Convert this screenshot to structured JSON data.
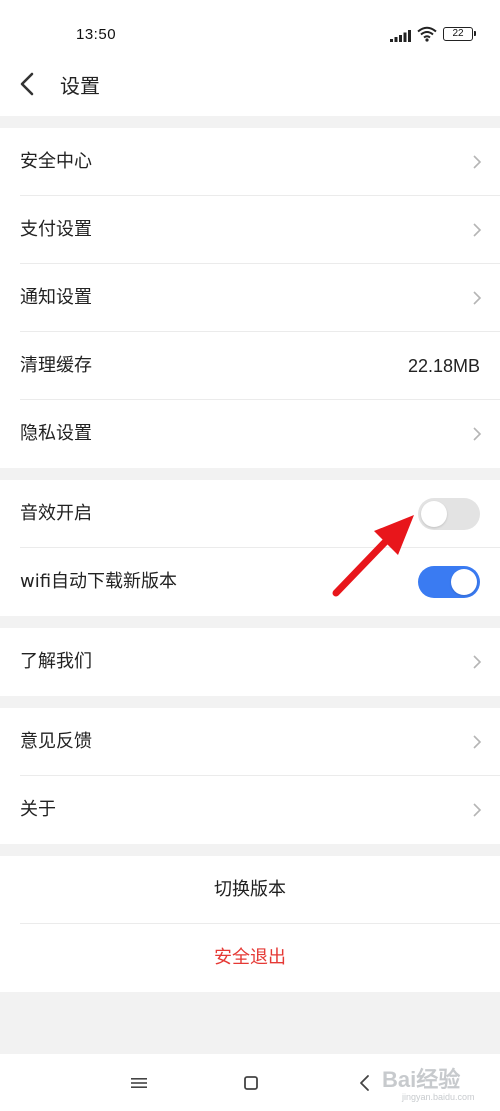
{
  "status_bar": {
    "time": "13:50",
    "battery": "22"
  },
  "header": {
    "back_icon": "chevron-left-icon",
    "title": "设置"
  },
  "groups": {
    "g1": {
      "security_center": "安全中心",
      "payment_settings": "支付设置",
      "notification_settings": "通知设置",
      "clear_cache": "清理缓存",
      "clear_cache_value": "22.18MB",
      "privacy_settings": "隐私设置"
    },
    "g2": {
      "sound_effects": "音效开启",
      "sound_effects_on": false,
      "wifi_auto_download": "wifi自动下载新版本",
      "wifi_auto_download_on": true
    },
    "g3": {
      "about_us": "了解我们"
    },
    "g4": {
      "feedback": "意见反馈",
      "about": "关于"
    },
    "g5": {
      "switch_version": "切换版本",
      "logout": "安全退出"
    }
  },
  "colors": {
    "toggle_on": "#3a7bf2",
    "toggle_off": "#e3e3e3",
    "danger": "#e53935",
    "annotation_arrow": "#e8161b"
  },
  "bottom_nav": {
    "menu_icon": "menu-icon",
    "home_icon": "square-home-icon",
    "back_icon": "back-triangle-icon"
  },
  "watermark": {
    "text": "Bai经验",
    "sub": "jingyan.baidu.com"
  }
}
